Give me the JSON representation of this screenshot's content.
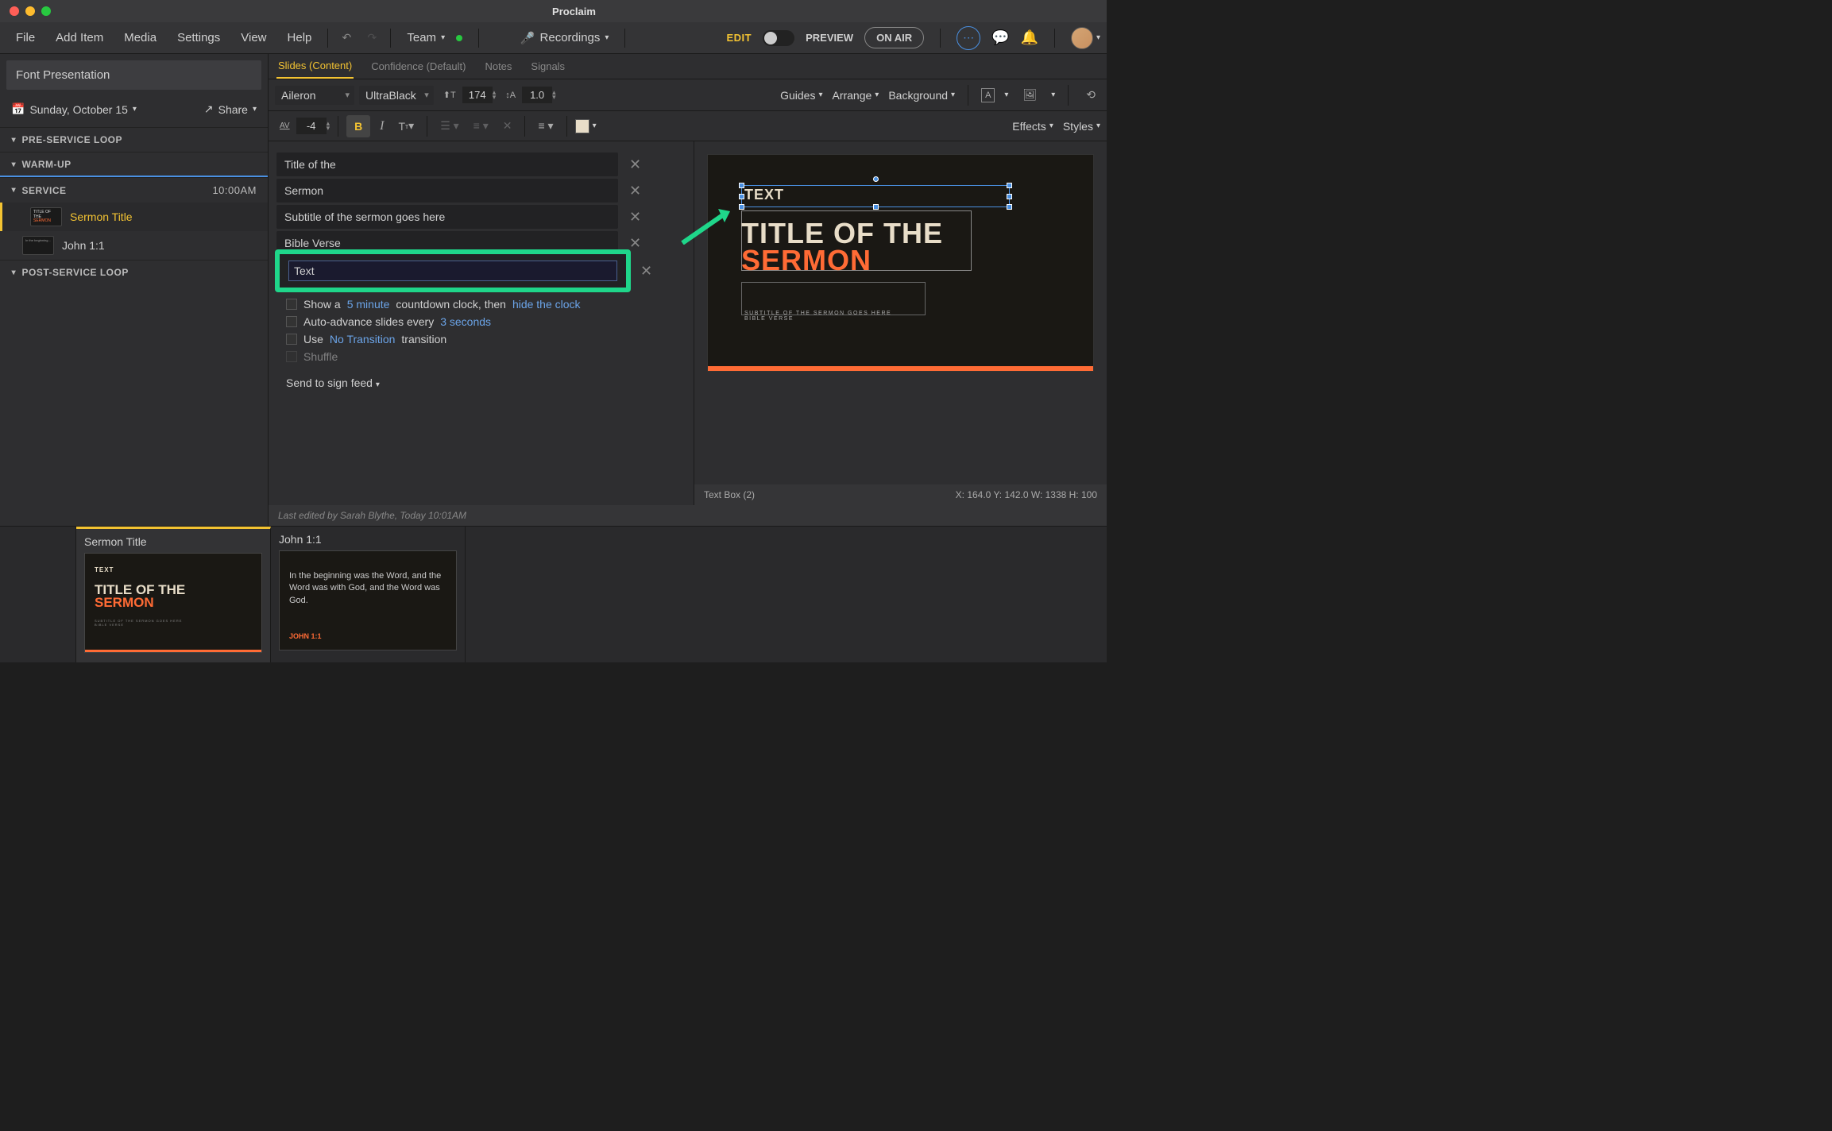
{
  "app": {
    "title": "Proclaim"
  },
  "menu": {
    "file": "File",
    "addItem": "Add Item",
    "media": "Media",
    "settings": "Settings",
    "view": "View",
    "help": "Help",
    "team": "Team",
    "recordings": "Recordings",
    "edit": "EDIT",
    "preview": "PREVIEW",
    "onAir": "ON AIR"
  },
  "sidebar": {
    "presentationName": "Font Presentation",
    "date": "Sunday, October 15",
    "share": "Share",
    "sections": {
      "preService": "PRE-SERVICE LOOP",
      "warmUp": "WARM-UP",
      "service": "SERVICE",
      "serviceTime": "10:00AM",
      "postService": "POST-SERVICE LOOP"
    },
    "items": [
      {
        "label": "Sermon Title"
      },
      {
        "label": "John 1:1"
      }
    ]
  },
  "tabs": {
    "slides": "Slides (Content)",
    "confidence": "Confidence (Default)",
    "notes": "Notes",
    "signals": "Signals"
  },
  "toolbar": {
    "font": "Aileron",
    "weight": "UltraBlack",
    "size": "174",
    "lineHeight": "1.0",
    "tracking": "-4",
    "guides": "Guides",
    "arrange": "Arrange",
    "background": "Background",
    "effects": "Effects",
    "styles": "Styles"
  },
  "fields": {
    "f1": "Title of the",
    "f2": "Sermon",
    "f3": "Subtitle of the sermon goes here",
    "f4": "Bible Verse",
    "f5": "Text"
  },
  "options": {
    "showA": "Show a",
    "fiveMin": "5 minute",
    "countdownThen": "countdown clock, then",
    "hideClock": "hide the clock",
    "autoAdvance": "Auto-advance slides every",
    "threeSec": "3 seconds",
    "use": "Use",
    "noTransition": "No Transition",
    "transition": "transition",
    "shuffle": "Shuffle",
    "sendToSign": "Send to sign feed"
  },
  "status": {
    "lastEdited": "Last edited by Sarah Blythe, Today 10:01AM",
    "selection": "Text Box (2)",
    "coords": "X: 164.0  Y: 142.0    W: 1338  H: 100"
  },
  "preview": {
    "textLabel": "TEXT",
    "title1": "TITLE OF THE",
    "title2": "SERMON",
    "subtitle": "SUBTITLE OF THE SERMON GOES HERE",
    "bibleVerse": "BIBLE VERSE"
  },
  "timeline": {
    "item1": {
      "label": "Sermon Title",
      "text": "TEXT",
      "title1": "TITLE OF THE",
      "title2": "SERMON",
      "sub": "SUBTITLE OF THE SERMON GOES HERE\nBIBLE VERSE"
    },
    "item2": {
      "label": "John 1:1",
      "verse": "In the beginning was the Word, and the Word was with God, and the Word was God.",
      "ref": "JOHN 1:1"
    }
  }
}
